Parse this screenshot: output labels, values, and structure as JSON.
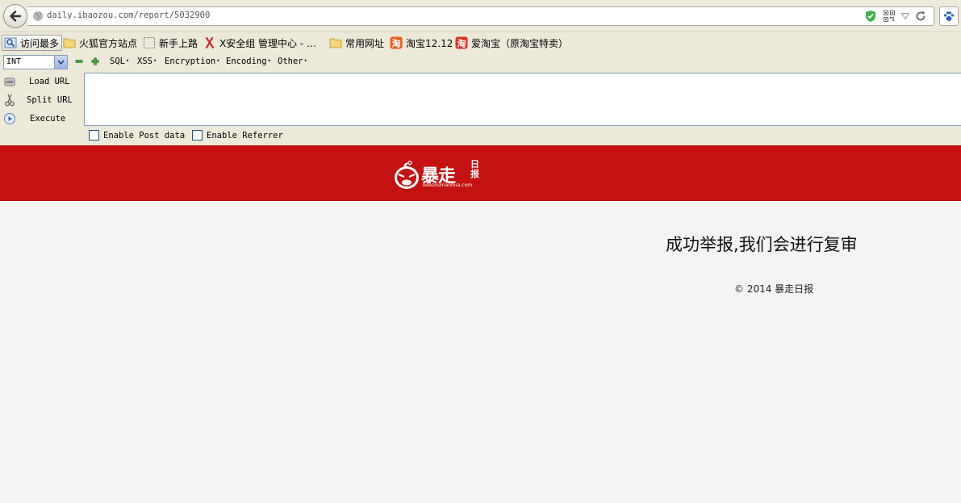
{
  "browser": {
    "url": "daily.ibaozou.com/report/5032900"
  },
  "bookmarks": [
    {
      "label": "访问最多",
      "icon": "magnifier-icon"
    },
    {
      "label": "火狐官方站点",
      "icon": "folder-icon"
    },
    {
      "label": "新手上路",
      "icon": "dashed-page-icon"
    },
    {
      "label": "X安全组 管理中心 - …",
      "icon": "x-logo-icon"
    },
    {
      "label": "常用网址",
      "icon": "folder-icon"
    },
    {
      "label": "淘宝12.12",
      "icon": "taobao-icon"
    },
    {
      "label": "爱淘宝（原淘宝特卖）",
      "icon": "taobao-icon"
    }
  ],
  "hackbar": {
    "select_value": "INT",
    "menus": [
      "SQL",
      "XSS",
      "Encryption",
      "Encoding",
      "Other"
    ],
    "actions": [
      "Load URL",
      "Split URL",
      "Execute"
    ],
    "checkboxes": [
      "Enable Post data",
      "Enable Referrer"
    ],
    "textarea_value": ""
  },
  "page": {
    "logo_text": "暴走",
    "logo_small": "日报",
    "logo_domain": "baozoumanhua.com",
    "header_color": "#c41111",
    "message": "成功举报,我们会进行复审",
    "copyright": "© 2014 暴走日报"
  }
}
